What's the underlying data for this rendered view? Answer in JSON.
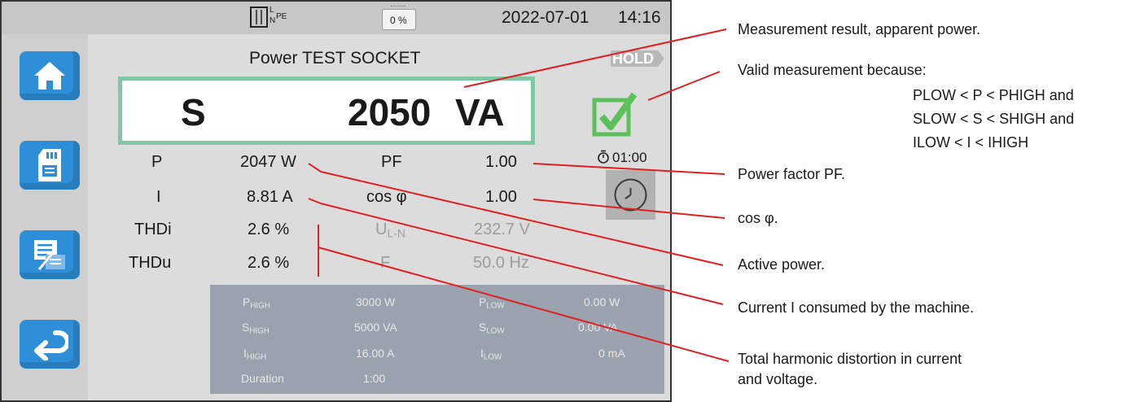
{
  "status": {
    "date": "2022-07-01",
    "time": "14:16",
    "battery_label": "0 %",
    "conn_L": "L",
    "conn_N": "N",
    "conn_PE": "PE"
  },
  "title": "Power TEST SOCKET",
  "hold_label": "HOLD",
  "main_result": {
    "symbol": "S",
    "value": "2050",
    "unit": "VA"
  },
  "timer": "01:00",
  "measurements": [
    {
      "label": "P",
      "value": "2047 W",
      "label2": "PF",
      "value2": "1.00"
    },
    {
      "label": "I",
      "value": "8.81 A",
      "label2": "cos φ",
      "value2": "1.00"
    },
    {
      "label": "THDi",
      "value": "2.6 %",
      "label2_main": "U",
      "label2_sub": "L-N",
      "value2": "232.7 V"
    },
    {
      "label": "THDu",
      "value": "2.6 %",
      "label2": "F",
      "value2": "50.0 Hz"
    }
  ],
  "limits": {
    "phigh_main": "P",
    "phigh_sub": "HIGH",
    "phigh_val": "3000 W",
    "plow_main": "P",
    "plow_sub": "LOW",
    "plow_val": "0.00 W",
    "shigh_main": "S",
    "shigh_sub": "HIGH",
    "shigh_val": "5000 VA",
    "slow_main": "S",
    "slow_sub": "LOW",
    "slow_val": "0.00 VA",
    "ihigh_main": "I",
    "ihigh_sub": "HIGH",
    "ihigh_val": "16.00 A",
    "ilow_main": "I",
    "ilow_sub": "LOW",
    "ilow_val": "0 mA",
    "duration_label": "Duration",
    "duration_val": "1:00"
  },
  "annotations": {
    "a1": "Measurement result, apparent power.",
    "a2": "Valid measurement because:",
    "cond1": {
      "v1": "P",
      "s1": "LOW",
      "mid": " < P < ",
      "v2": "P",
      "s2": "HIGH",
      "tail": " and"
    },
    "cond2": {
      "v1": "S",
      "s1": "LOW",
      "mid": " < S < ",
      "v2": "S",
      "s2": "HIGH",
      "tail": " and"
    },
    "cond3": {
      "v1": "I",
      "s1": "LOW",
      "mid": " < I < ",
      "v2": "I",
      "s2": "HIGH",
      "tail": ""
    },
    "a3": "Power factor PF.",
    "a4": "cos φ.",
    "a5": "Active power.",
    "a6": "Current I consumed by the machine.",
    "a7a": "Total harmonic distortion in current",
    "a7b": "and voltage."
  },
  "colors": {
    "accent_blue": "#2e8fd8",
    "valid_green": "#5cc15a",
    "frame_green": "#7ec8a6",
    "callout_red": "#e02020",
    "limits_bg": "#9aa3ad"
  }
}
